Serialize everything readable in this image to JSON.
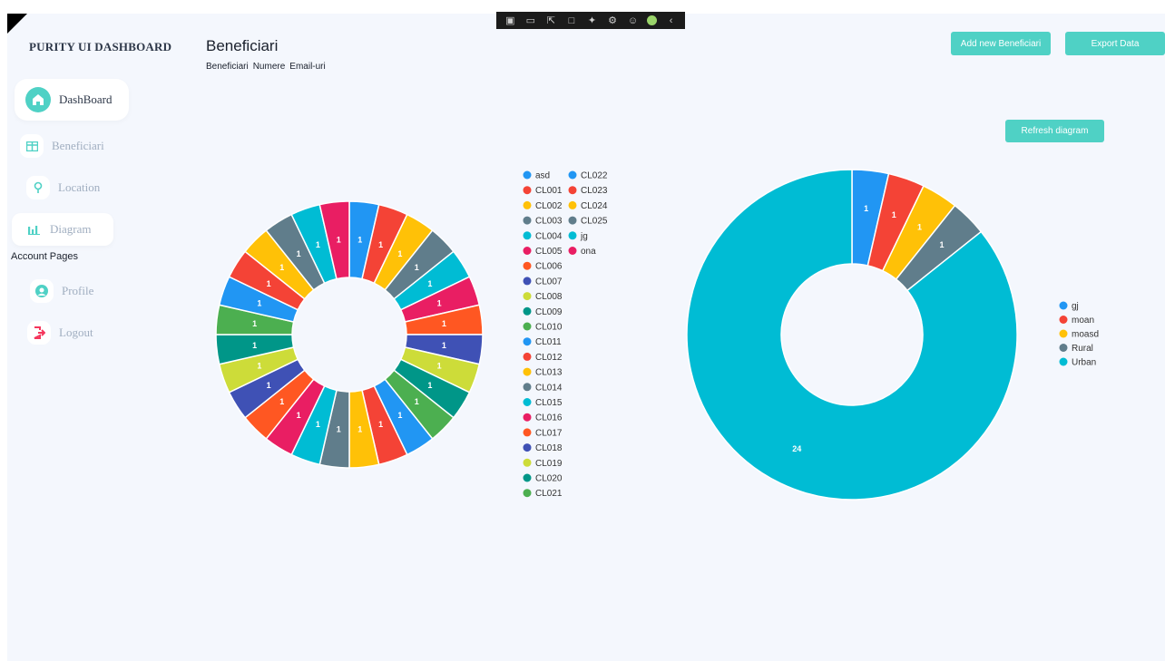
{
  "sidebar": {
    "brand": "PURITY UI DASHBOARD",
    "items": [
      {
        "label": "DashBoard",
        "icon": "home-icon"
      },
      {
        "label": "Beneficiari",
        "icon": "table-icon"
      },
      {
        "label": "Location",
        "icon": "location-pin-icon"
      },
      {
        "label": "Diagram",
        "icon": "bar-chart-icon"
      }
    ],
    "account_section": "Account Pages",
    "account_items": [
      {
        "label": "Profile",
        "icon": "profile-icon"
      },
      {
        "label": "Logout",
        "icon": "logout-icon"
      }
    ]
  },
  "header": {
    "title": "Beneficiari",
    "tabs": [
      "Beneficiari",
      "Numere",
      "Email-uri"
    ]
  },
  "buttons": {
    "add": "Add new Beneficiari",
    "export": "Export Data",
    "refresh": "Refresh diagram"
  },
  "colors": {
    "accent": "#4fd1c5",
    "palette": [
      "#2196f3",
      "#f44336",
      "#ffc107",
      "#607d8b",
      "#00bcd4",
      "#e91e63",
      "#ff5722",
      "#3f51b5",
      "#cddc39",
      "#009688",
      "#4caf50"
    ]
  },
  "chart_data": [
    {
      "type": "pie",
      "donut": true,
      "legend_position": "right",
      "categories": [
        "asd",
        "CL001",
        "CL002",
        "CL003",
        "CL004",
        "CL005",
        "CL006",
        "CL007",
        "CL008",
        "CL009",
        "CL010",
        "CL011",
        "CL012",
        "CL013",
        "CL014",
        "CL015",
        "CL016",
        "CL017",
        "CL018",
        "CL019",
        "CL020",
        "CL021",
        "CL022",
        "CL023",
        "CL024",
        "CL025",
        "jg",
        "ona"
      ],
      "values": [
        1,
        1,
        1,
        1,
        1,
        1,
        1,
        1,
        1,
        1,
        1,
        1,
        1,
        1,
        1,
        1,
        1,
        1,
        1,
        1,
        1,
        1,
        1,
        1,
        1,
        1,
        1,
        1
      ]
    },
    {
      "type": "pie",
      "donut": true,
      "legend_position": "right",
      "categories": [
        "gj",
        "moan",
        "moasd",
        "Rural",
        "Urban"
      ],
      "values": [
        1,
        1,
        1,
        1,
        24
      ]
    }
  ]
}
